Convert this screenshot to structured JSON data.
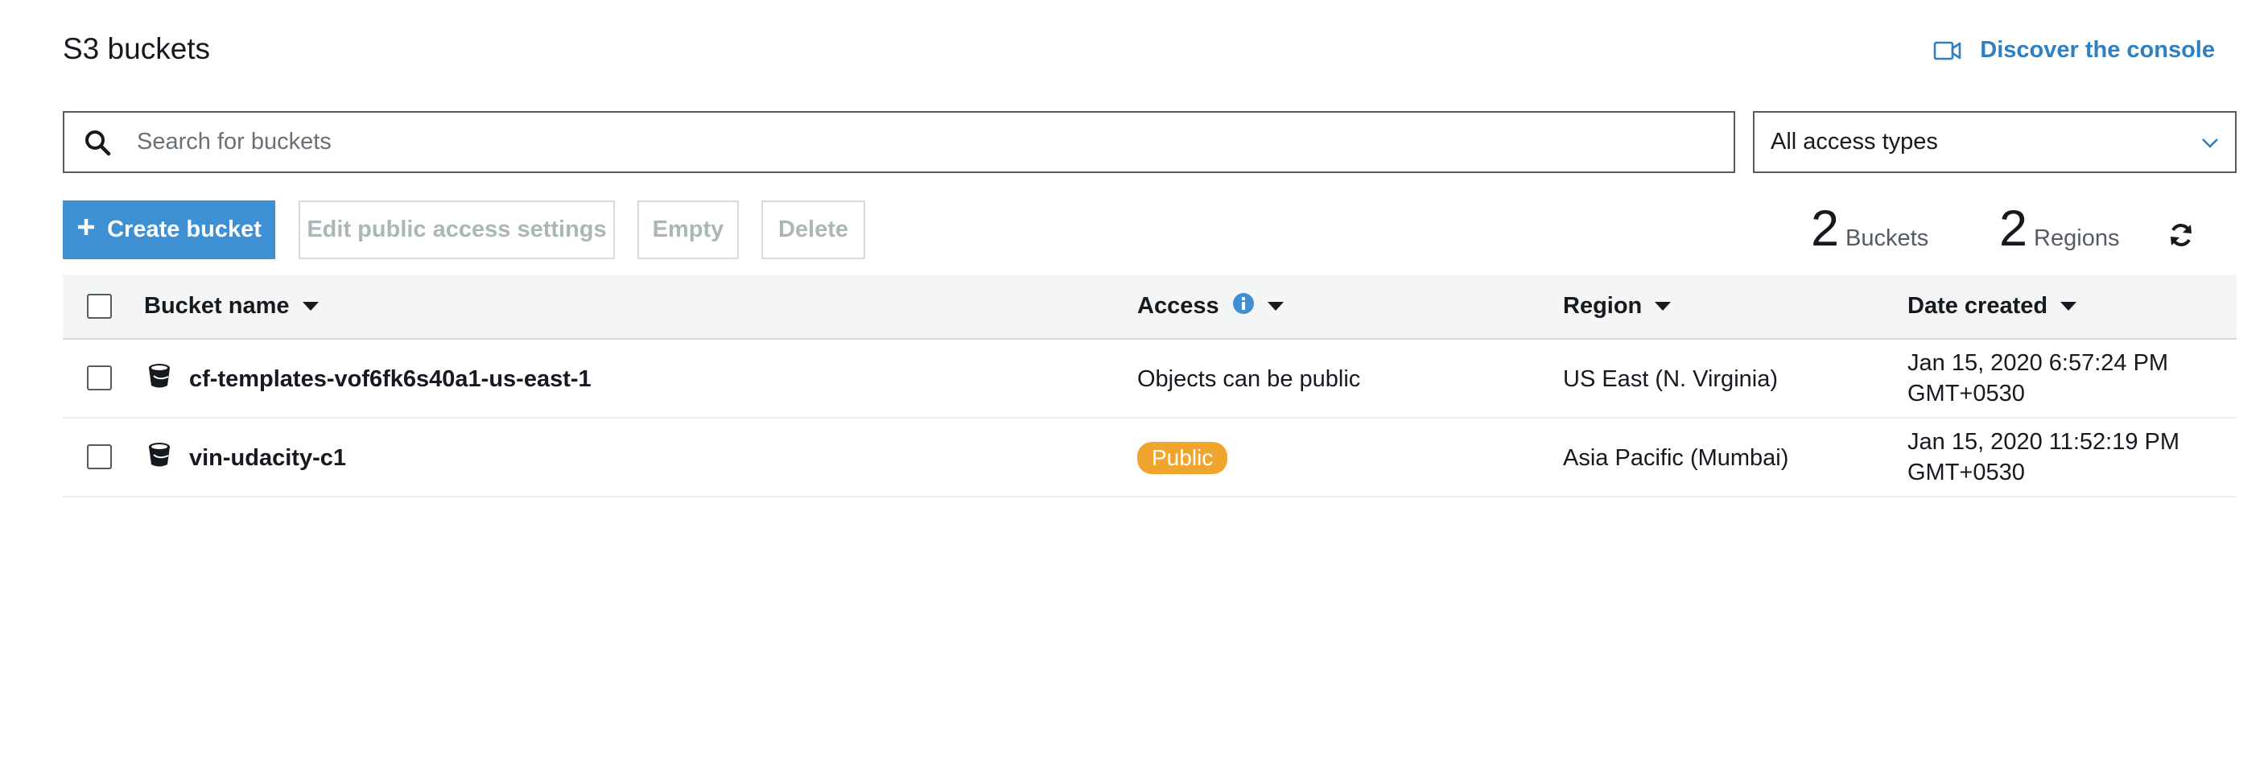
{
  "header": {
    "title": "S3 buckets",
    "discover_link": "Discover the console",
    "discover_icon": "video-camera-icon"
  },
  "search": {
    "placeholder": "Search for buckets",
    "value": ""
  },
  "access_filter": {
    "selected": "All access types"
  },
  "toolbar": {
    "create_label": "Create bucket",
    "edit_label": "Edit public access settings",
    "empty_label": "Empty",
    "delete_label": "Delete"
  },
  "stats": {
    "buckets_count": "2",
    "buckets_label": "Buckets",
    "regions_count": "2",
    "regions_label": "Regions"
  },
  "table": {
    "columns": {
      "name": "Bucket name",
      "access": "Access",
      "region": "Region",
      "date": "Date created"
    },
    "rows": [
      {
        "name": "cf-templates-vof6fk6s40a1-us-east-1",
        "access": "Objects can be public",
        "access_badge": false,
        "region": "US East (N. Virginia)",
        "date_line1": "Jan 15, 2020 6:57:24 PM",
        "date_line2": "GMT+0530"
      },
      {
        "name": "vin-udacity-c1",
        "access": "Public",
        "access_badge": true,
        "region": "Asia Pacific (Mumbai)",
        "date_line1": "Jan 15, 2020 11:52:19 PM",
        "date_line2": "GMT+0530"
      }
    ]
  },
  "colors": {
    "accent": "#3f8fd3",
    "link": "#2f7fc1",
    "public_badge": "#f0a52f",
    "info_icon": "#3f8fd3"
  }
}
